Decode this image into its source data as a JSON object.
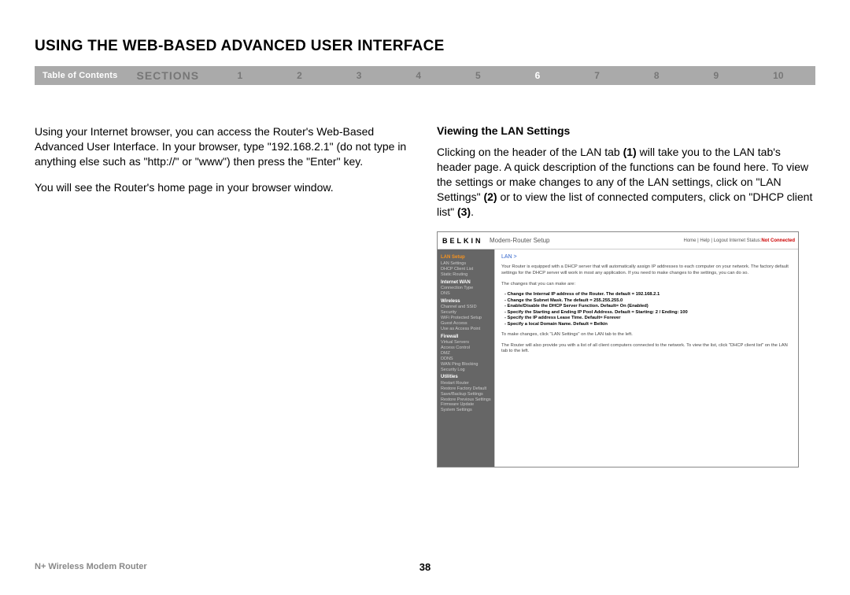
{
  "title": "USING THE WEB-BASED ADVANCED USER INTERFACE",
  "navbar": {
    "toc": "Table of Contents",
    "sections_label": "SECTIONS",
    "numbers": [
      "1",
      "2",
      "3",
      "4",
      "5",
      "6",
      "7",
      "8",
      "9",
      "10"
    ],
    "active": "6"
  },
  "left_col": {
    "p1": "Using your Internet browser, you can access the Router's Web-Based Advanced User Interface. In your browser, type \"192.168.2.1\" (do not type in anything else such as \"http://\" or \"www\") then press the \"Enter\" key.",
    "p2": "You will see the Router's home page in your browser window."
  },
  "right_col": {
    "heading": "Viewing the LAN Settings",
    "p1_a": "Clicking on the header of the LAN tab ",
    "p1_b1": "(1)",
    "p1_c": " will take you to the LAN tab's header page. A quick description of the functions can be found here. To view the settings or make changes to any of the LAN settings, click on \"LAN Settings\" ",
    "p1_b2": "(2)",
    "p1_d": " or to view the list of connected computers, click on \"DHCP client list\" ",
    "p1_b3": "(3)",
    "p1_e": "."
  },
  "screenshot": {
    "logo": "BELKIN",
    "title": "Modem-Router Setup",
    "links": "Home | Help | Logout   Internet Status:",
    "status": "Not Connected",
    "side": {
      "lan_setup": "LAN Setup",
      "lan_items": [
        "LAN Settings",
        "DHCP Client List",
        "Static Routing"
      ],
      "wan": "Internet WAN",
      "wan_items": [
        "Connection Type",
        "DNS"
      ],
      "wireless": "Wireless",
      "wireless_items": [
        "Channel and SSID",
        "Security",
        "WiFi Protected Setup",
        "Guest Access",
        "Use as Access Point"
      ],
      "firewall": "Firewall",
      "firewall_items": [
        "Virtual Servers",
        "Access Control",
        "DMZ",
        "DDNS",
        "WAN Ping Blocking",
        "Security Log"
      ],
      "utilities": "Utilities",
      "util_items": [
        "Restart Router",
        "Restore Factory Default",
        "Save/Backup Settings",
        "Restore Previous Settings",
        "Firmware Update",
        "System Settings"
      ]
    },
    "main": {
      "crumb": "LAN >",
      "para1": "Your Router is equipped with a DHCP server that will automatically assign IP addresses to each computer on your network. The factory default settings for the DHCP server will work in most any application. If you need to make changes to the settings, you can do so.",
      "para2": "The changes that you can make are:",
      "b1": "- Change the Internal IP address of the Router. The default = 192.168.2.1",
      "b2": "- Change the Subnet Mask. The default = 255.255.255.0",
      "b3": "- Enable/Disable the DHCP Server Function. Default= On (Enabled)",
      "b4": "- Specify the Starting and Ending IP Pool Address. Default = Starting: 2 / Ending: 100",
      "b5": "- Specify the IP address Lease Time. Default= Forever",
      "b6": "- Specify a local Domain Name. Default = Belkin",
      "para3": "To make changes, click \"LAN Settings\" on the LAN tab to the left.",
      "para4": "The Router will also provide you with a list of all client computers connected to the network. To view the list, click \"DHCP client list\" on the LAN tab to the left."
    }
  },
  "footer": {
    "product": "N+ Wireless Modem Router",
    "page": "38"
  }
}
